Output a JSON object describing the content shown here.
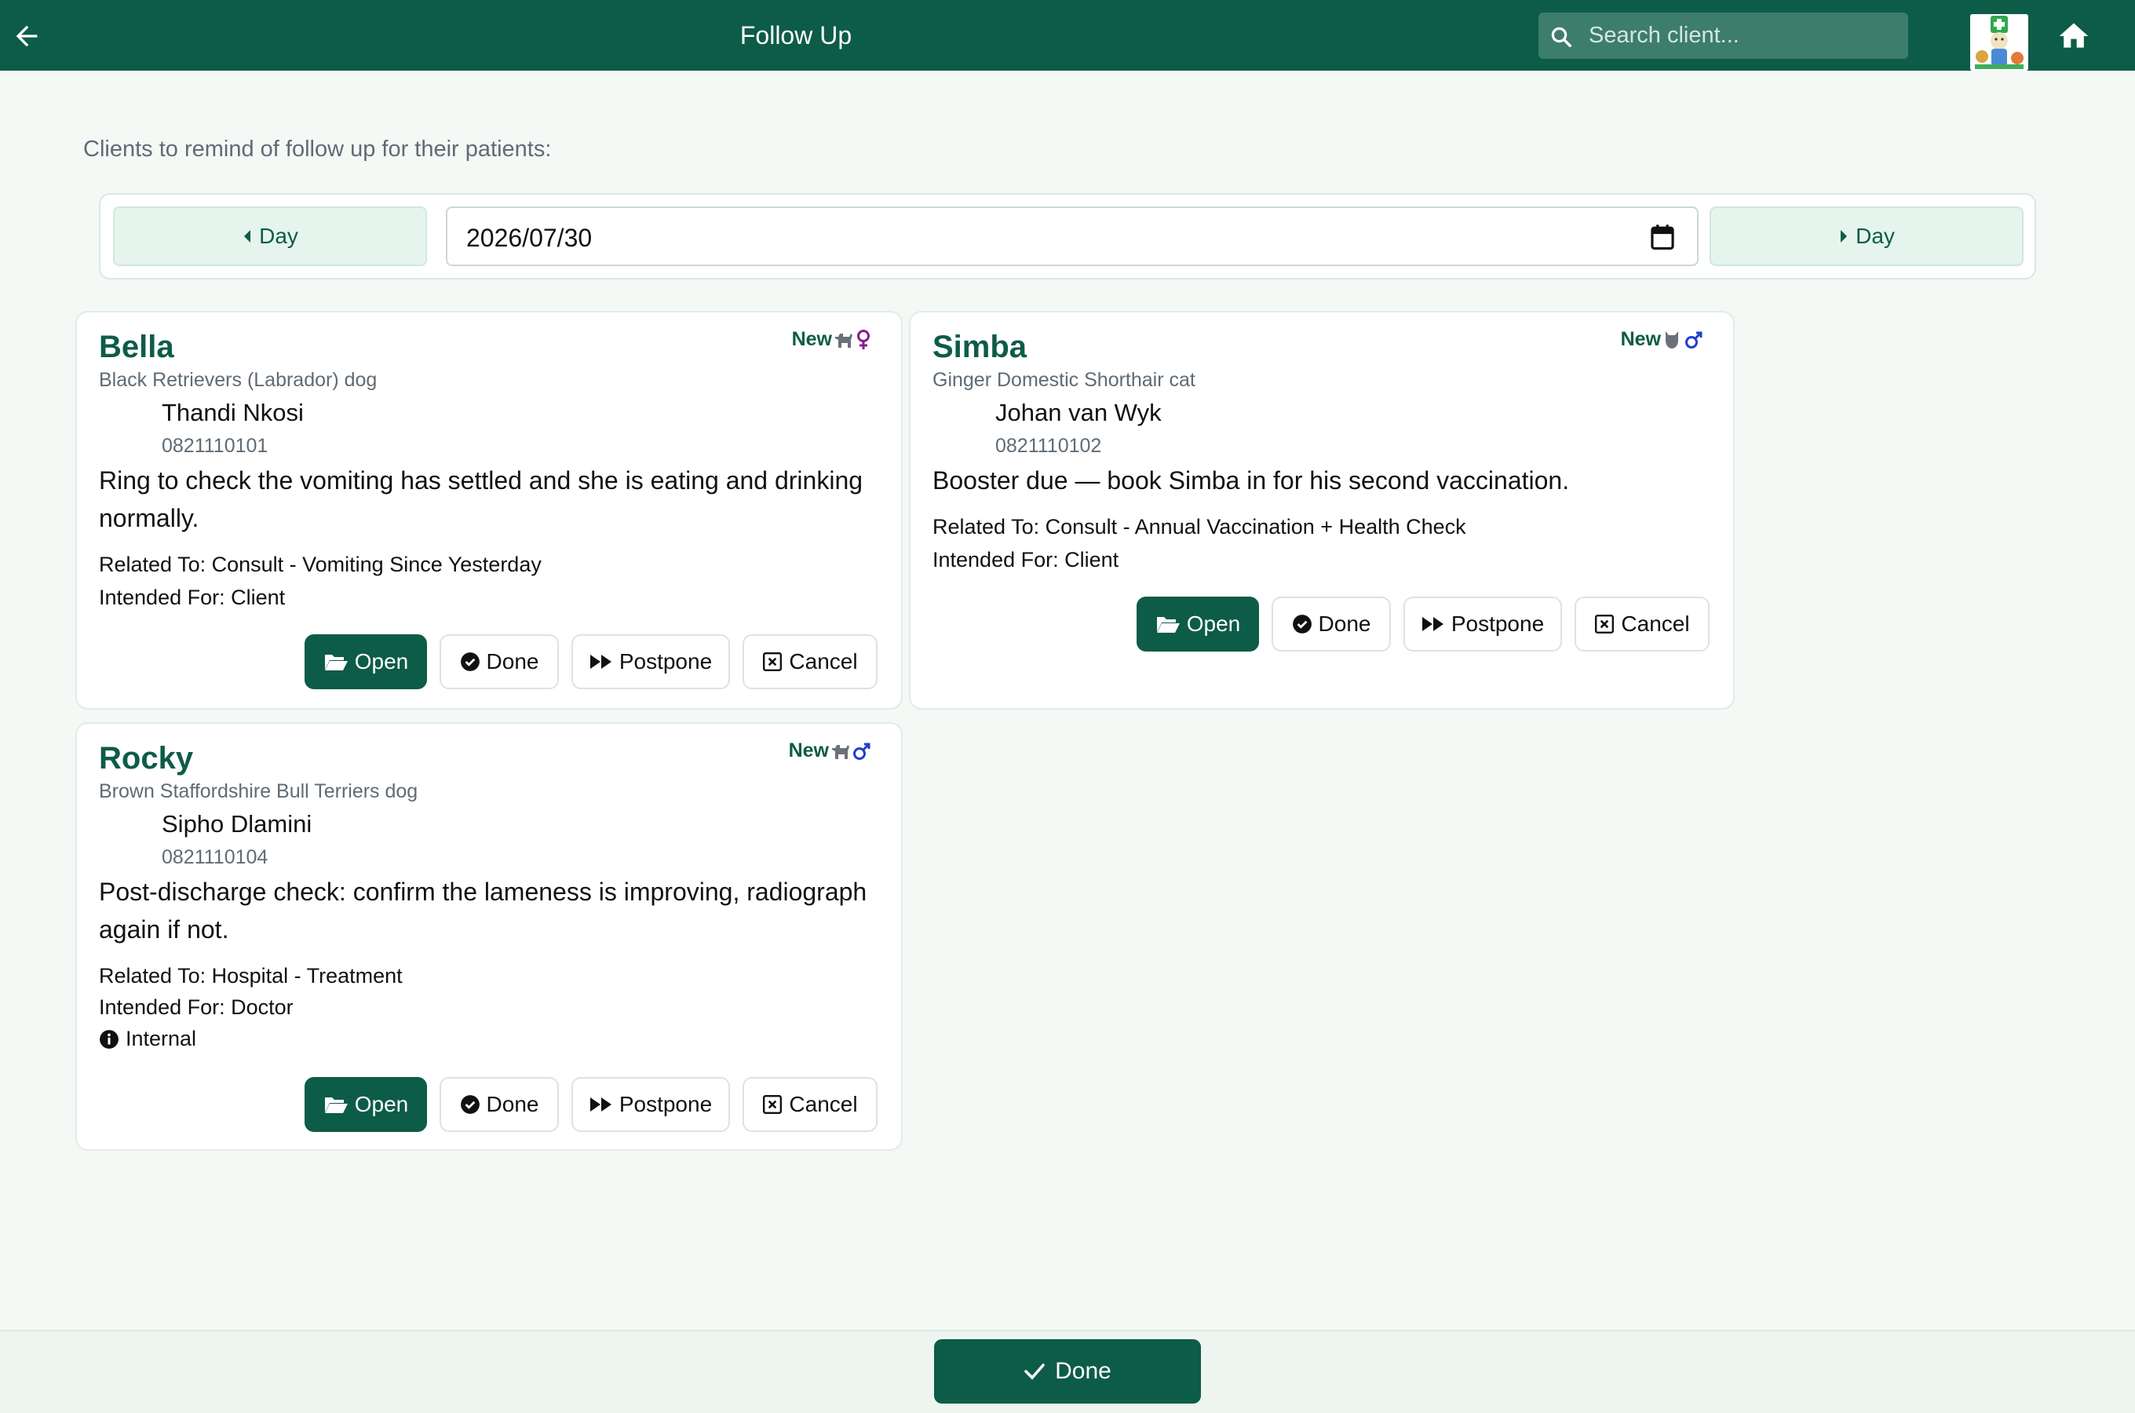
{
  "header": {
    "title": "Follow Up",
    "search_placeholder": "Search client...",
    "back_icon": "arrow-left-icon",
    "home_icon": "home-icon",
    "logo": "clinic-logo"
  },
  "intro_text": "Clients to remind of follow up for their patients:",
  "date_nav": {
    "prev_label": "Day",
    "next_label": "Day",
    "date_value": "2026/07/30"
  },
  "cards": [
    {
      "pet_name": "Bella",
      "breed": "Black Retrievers (Labrador) dog",
      "owner": "Thandi Nkosi",
      "phone": "0821110101",
      "note": "Ring to check the vomiting has settled and she is eating and drinking normally.",
      "related": "Related To: Consult - Vomiting Since Yesterday",
      "intended": "Intended For: Client",
      "badge": "New",
      "species_icon": "dog-icon",
      "sex_icon": "female-icon"
    },
    {
      "pet_name": "Simba",
      "breed": "Ginger Domestic Shorthair cat",
      "owner": "Johan van Wyk",
      "phone": "0821110102",
      "note": "Booster due — book Simba in for his second vaccination.",
      "related": "Related To: Consult - Annual Vaccination + Health Check",
      "intended": "Intended For: Client",
      "badge": "New",
      "species_icon": "cat-icon",
      "sex_icon": "male-icon"
    },
    {
      "pet_name": "Rocky",
      "breed": "Brown Staffordshire Bull Terriers dog",
      "owner": "Sipho Dlamini",
      "phone": "0821110104",
      "note": "Post-discharge check: confirm the lameness is improving, radiograph again if not.",
      "related": "Related To: Hospital - Treatment",
      "intended": "Intended For: Doctor",
      "internal": "Internal",
      "badge": "New",
      "species_icon": "dog-icon",
      "sex_icon": "male-icon"
    }
  ],
  "actions": {
    "open": "Open",
    "done": "Done",
    "postpone": "Postpone",
    "cancel": "Cancel"
  },
  "footer": {
    "done_label": "Done"
  },
  "colors": {
    "brand": "#0d5c47",
    "female": "#8a1c8c",
    "male": "#1f3fd1"
  }
}
